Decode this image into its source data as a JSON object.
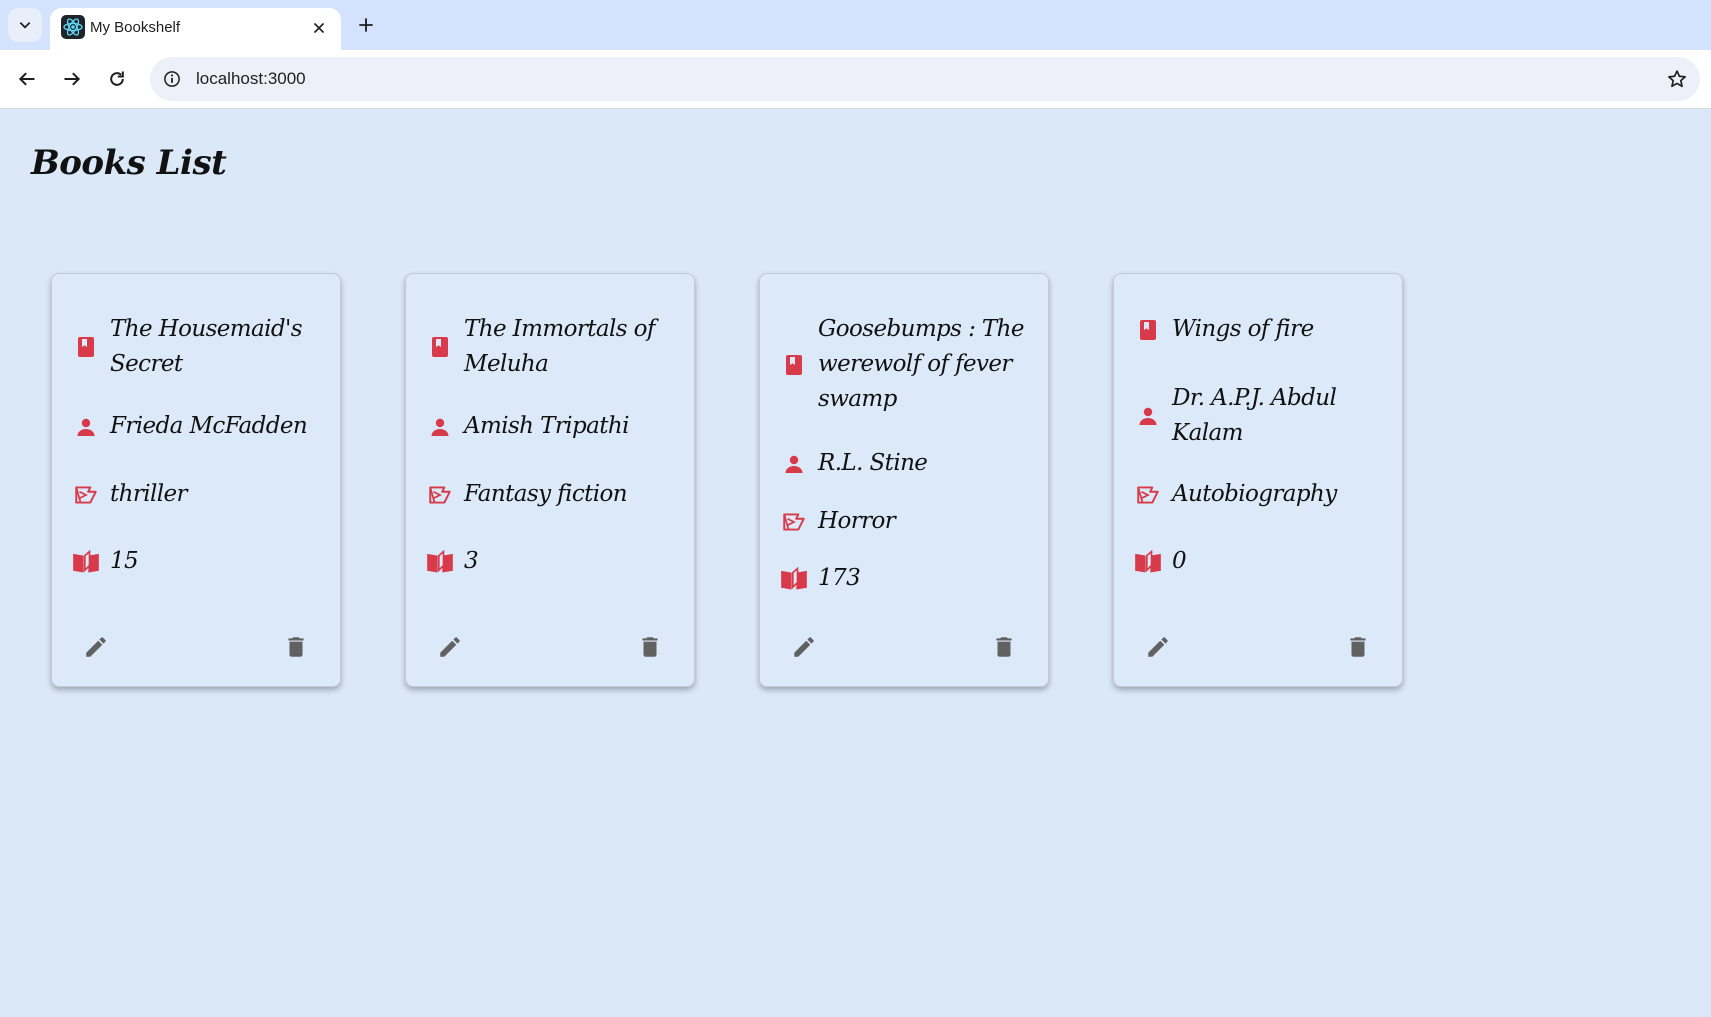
{
  "browser": {
    "tab_title": "My Bookshelf",
    "url": "localhost:3000",
    "icons": {
      "tab_search": "chevron-down-icon",
      "favicon": "react-icon",
      "close": "close-icon",
      "new_tab": "plus-icon",
      "back": "back-arrow-icon",
      "forward": "forward-arrow-icon",
      "reload": "reload-icon",
      "site_info": "info-icon",
      "bookmark": "star-icon"
    }
  },
  "page": {
    "title": "Books List"
  },
  "colors": {
    "accent": "#d83a4a",
    "background": "#dae8f8",
    "action_icon": "#616161"
  },
  "row_icons": [
    "book-icon",
    "person-icon",
    "genre-icon",
    "open-book-icon"
  ],
  "books": [
    {
      "title": "The Housemaid's Secret",
      "author": "Frieda McFadden",
      "genre": "thriller",
      "count": "15"
    },
    {
      "title": "The Immortals of Meluha",
      "author": "Amish Tripathi",
      "genre": "Fantasy fiction",
      "count": "3"
    },
    {
      "title": "Goosebumps : The werewolf of fever swamp",
      "author": "R.L. Stine",
      "genre": "Horror",
      "count": "173"
    },
    {
      "title": "Wings of fire",
      "author": "Dr. A.P.J. Abdul Kalam",
      "genre": "Autobiography",
      "count": "0"
    }
  ]
}
